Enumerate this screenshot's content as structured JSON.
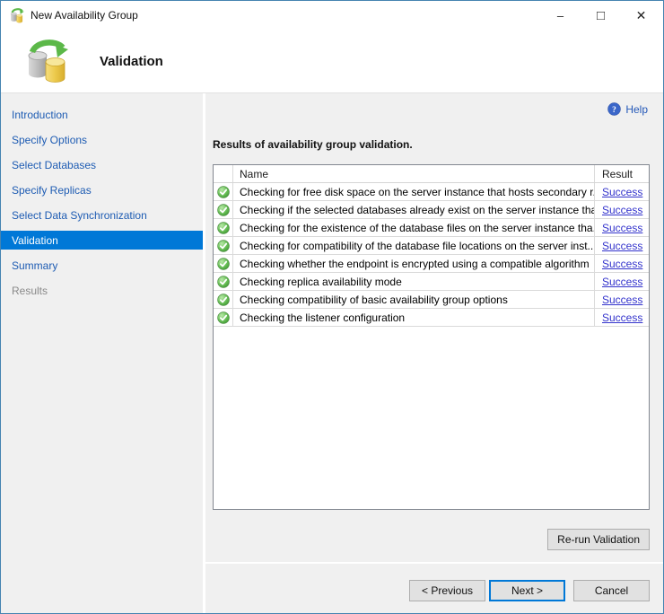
{
  "window": {
    "title": "New Availability Group",
    "controls": {
      "minimize": "–",
      "maximize": "□",
      "close": "✕"
    }
  },
  "header": {
    "title": "Validation"
  },
  "sidebar": {
    "items": [
      {
        "label": "Introduction",
        "state": "link"
      },
      {
        "label": "Specify Options",
        "state": "link"
      },
      {
        "label": "Select Databases",
        "state": "link"
      },
      {
        "label": "Specify Replicas",
        "state": "link"
      },
      {
        "label": "Select Data Synchronization",
        "state": "link"
      },
      {
        "label": "Validation",
        "state": "selected"
      },
      {
        "label": "Summary",
        "state": "link"
      },
      {
        "label": "Results",
        "state": "disabled"
      }
    ]
  },
  "content": {
    "help_label": "Help",
    "caption": "Results of availability group validation.",
    "table": {
      "columns": {
        "name": "Name",
        "result": "Result"
      },
      "rows": [
        {
          "icon": "success-check-icon",
          "name": "Checking for free disk space on the server instance that hosts secondary r...",
          "result": "Success"
        },
        {
          "icon": "success-check-icon",
          "name": "Checking if the selected databases already exist on the server instance tha...",
          "result": "Success"
        },
        {
          "icon": "success-check-icon",
          "name": "Checking for the existence of the database files on the server instance tha...",
          "result": "Success"
        },
        {
          "icon": "success-check-icon",
          "name": "Checking for compatibility of the database file locations on the server inst...",
          "result": "Success"
        },
        {
          "icon": "success-check-icon",
          "name": "Checking whether the endpoint is encrypted using a compatible algorithm",
          "result": "Success"
        },
        {
          "icon": "success-check-icon",
          "name": "Checking replica availability mode",
          "result": "Success"
        },
        {
          "icon": "success-check-icon",
          "name": "Checking compatibility of basic availability group options",
          "result": "Success"
        },
        {
          "icon": "success-check-icon",
          "name": "Checking the listener configuration",
          "result": "Success"
        }
      ]
    },
    "rerun_label": "Re-run Validation"
  },
  "footer": {
    "previous": "< Previous",
    "next": "Next >",
    "cancel": "Cancel"
  },
  "colors": {
    "accent": "#0078d7",
    "nav_link": "#1e5cb3",
    "success_link": "#3333cc",
    "success_green": "#4caa3f",
    "window_border": "#4584b1",
    "panel_bg": "#f0f0f0"
  }
}
